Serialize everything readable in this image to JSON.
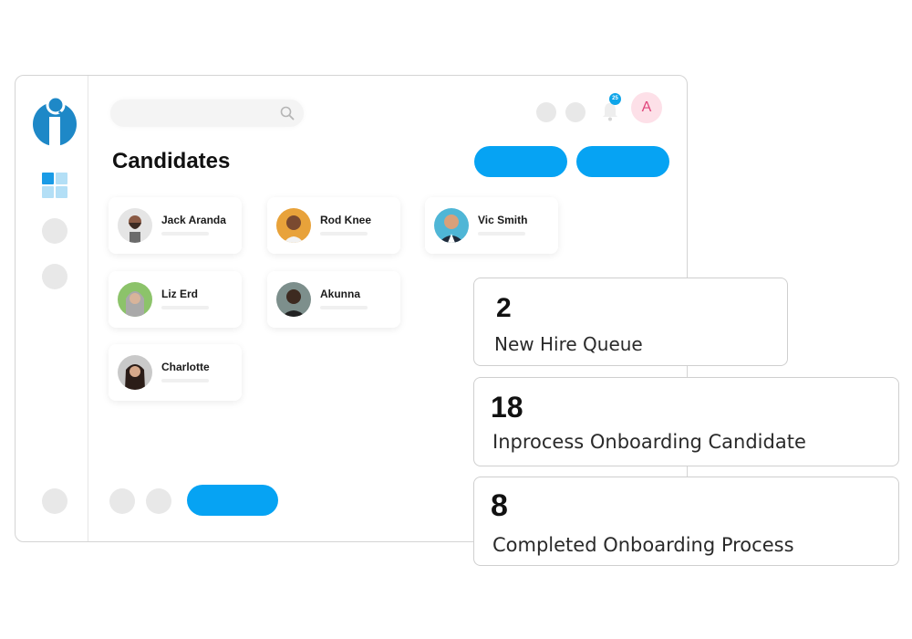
{
  "header": {
    "search_placeholder": "",
    "notification_count": "25",
    "user_initial": "A"
  },
  "page": {
    "title": "Candidates"
  },
  "candidates": [
    {
      "name": "Jack Aranda",
      "avatar_bg": "#e5e5e5"
    },
    {
      "name": "Rod Knee",
      "avatar_bg": "#e8a23a"
    },
    {
      "name": "Vic Smith",
      "avatar_bg": "#4fb6d6"
    },
    {
      "name": "Liz Erd",
      "avatar_bg": "#8cc36a"
    },
    {
      "name": "Akunna",
      "avatar_bg": "#7d8f8c"
    },
    {
      "name": "Charlotte",
      "avatar_bg": "#c9c9c9"
    }
  ],
  "stats": [
    {
      "value": "2",
      "label": "New Hire Queue"
    },
    {
      "value": "18",
      "label": "Inprocess Onboarding Candidate"
    },
    {
      "value": "8",
      "label": "Completed Onboarding Process"
    }
  ],
  "colors": {
    "accent": "#06a3f3",
    "logo": "#1e88c7",
    "avatar_pink_bg": "#fde0e8",
    "avatar_pink_text": "#e0457b"
  }
}
